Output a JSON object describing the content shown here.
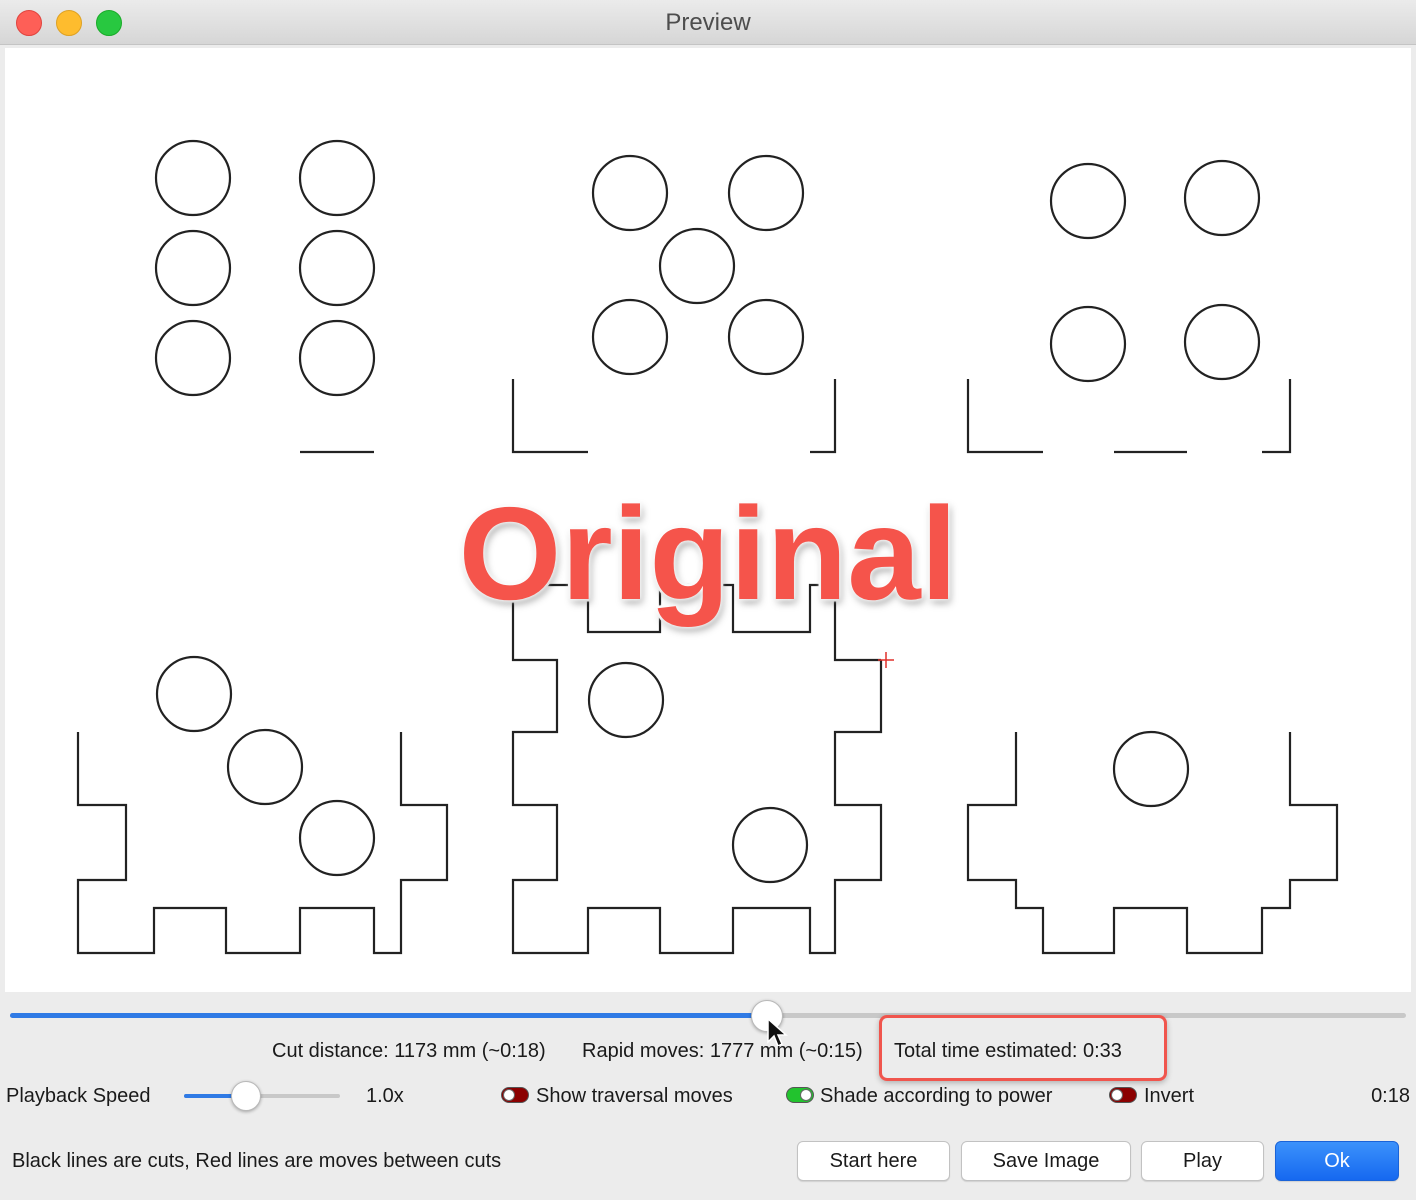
{
  "window": {
    "title": "Preview"
  },
  "overlay_text": "Original",
  "timeline": {
    "progress": 0.542
  },
  "stats": {
    "cut_distance": "Cut distance: 1173 mm (~0:18)",
    "rapid_moves": "Rapid moves: 1777 mm (~0:15)",
    "total_time": "Total time estimated: 0:33"
  },
  "controls": {
    "playback_label": "Playback Speed",
    "playback_speed_level": 0.4,
    "speed_value": "1.0x",
    "show_traversal": {
      "label": "Show traversal moves",
      "on": false
    },
    "shade_power": {
      "label": "Shade according to power",
      "on": true
    },
    "invert": {
      "label": "Invert",
      "on": false
    },
    "time_elapsed": "0:18"
  },
  "footer": {
    "legend": "Black lines are cuts, Red lines are moves between cuts",
    "buttons": {
      "start_here": "Start here",
      "save_image": "Save Image",
      "play": "Play",
      "ok": "Ok"
    }
  },
  "colors": {
    "accent": "#2f7ae5",
    "highlight": "#f0554d",
    "toggle_on": "#22c32e",
    "toggle_off": "#8b0000"
  }
}
